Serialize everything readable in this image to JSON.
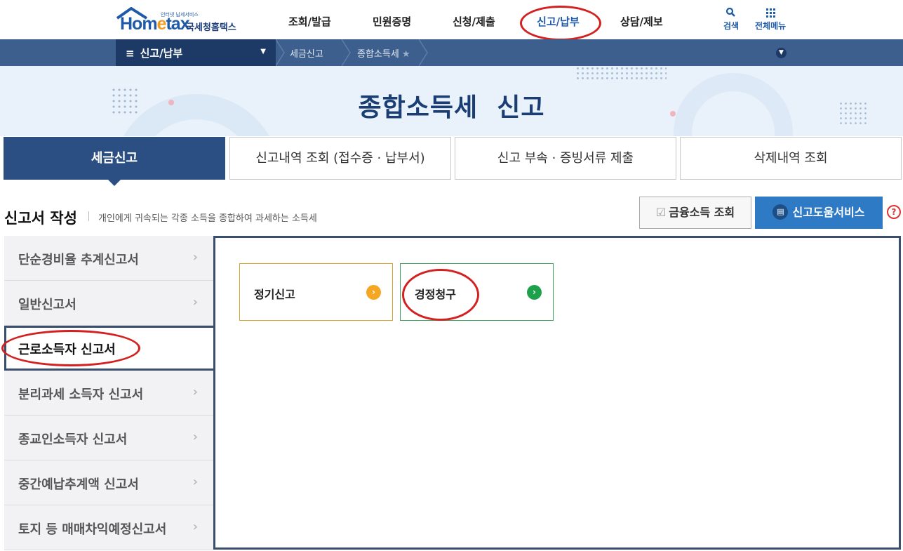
{
  "header": {
    "logo_tagline": "인터넷 납세서비스",
    "logo_brand_pre": "Hom",
    "logo_brand_e": "e",
    "logo_brand_post": "tax",
    "logo_sub": "국세청홈택스",
    "nav": [
      "조회/발급",
      "민원증명",
      "신청/제출",
      "신고/납부",
      "상담/제보"
    ],
    "active_nav": "신고/납부",
    "search_label": "검색",
    "menu_label": "전체메뉴"
  },
  "breadcrumb": {
    "main": "신고/납부",
    "item1": "세금신고",
    "item2": "종합소득세"
  },
  "hero": {
    "title": "종합소득세  신고"
  },
  "tabs": [
    "세금신고",
    "신고내역 조회 (접수증 · 납부서)",
    "신고 부속 · 증빙서류 제출",
    "삭제내역 조회"
  ],
  "section": {
    "title": "신고서 작성",
    "desc": "개인에게 귀속되는 각종 소득을 종합하여 과세하는 소득세",
    "btn_financial": "금융소득 조회",
    "btn_help": "신고도움서비스",
    "help_q": "?"
  },
  "left_menu": [
    "단순경비율 추계신고서",
    "일반신고서",
    "근로소득자 신고서",
    "분리과세 소득자 신고서",
    "종교인소득자 신고서",
    "중간예납추계액 신고서",
    "토지 등 매매차익예정신고서"
  ],
  "left_menu_active": "근로소득자 신고서",
  "cards": [
    {
      "label": "정기신고",
      "color": "#f5a623",
      "border": "#d8a52c"
    },
    {
      "label": "경정청구",
      "color": "#1fa04a",
      "border": "#3aa35a"
    }
  ],
  "colors": {
    "brand": "#1e5aa8",
    "dark_navy": "#1d3a66",
    "annotation_red": "#d32020"
  }
}
